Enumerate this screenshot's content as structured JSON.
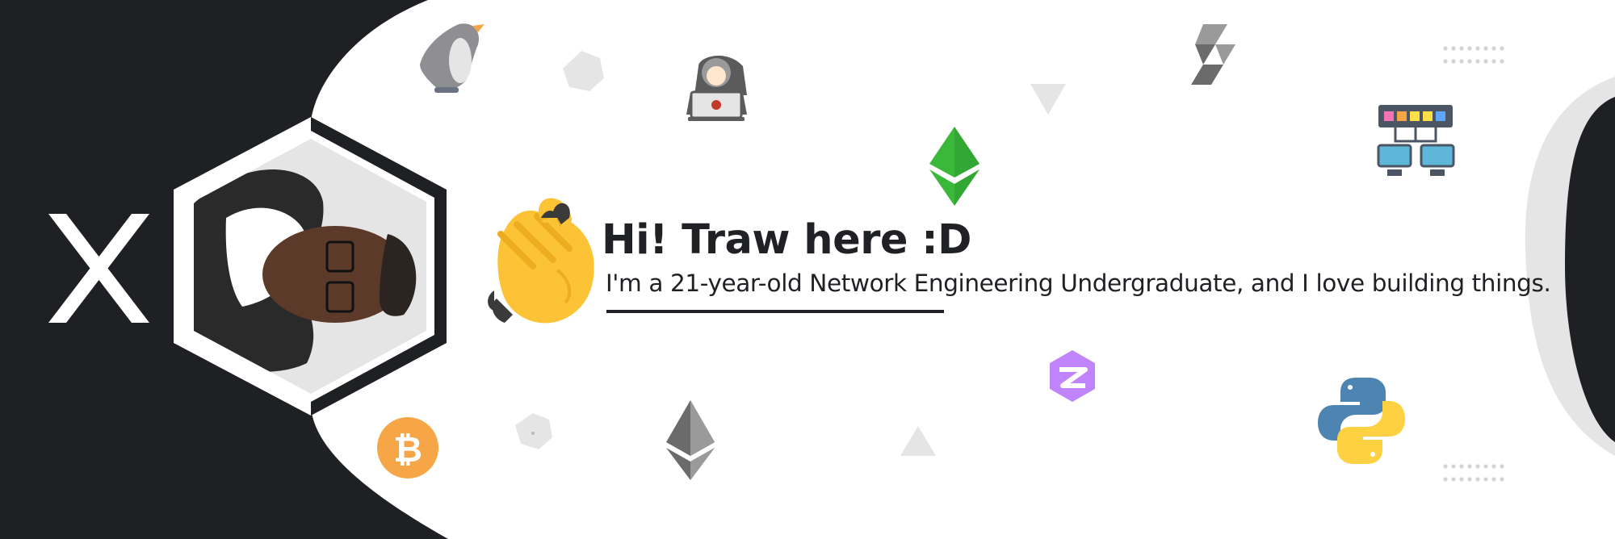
{
  "banner": {
    "headline": "Hi! Traw here :D",
    "tagline": "I'm a 21-year-old Network Engineering Undergraduate, and I love building things."
  },
  "logo": {
    "name": "x-logo-icon",
    "color": "#ffffff"
  },
  "avatar": {
    "name": "avatar"
  },
  "decor_icons": [
    "penguin-icon",
    "hacker-icon",
    "ethereum-classic-icon",
    "solidity-icon",
    "network-icon",
    "bitcoin-icon",
    "ethereum-icon",
    "zksync-icon",
    "python-icon",
    "wave-hand-icon"
  ],
  "colors": {
    "dark": "#1f2024",
    "light_grey": "#e5e5e5",
    "bitcoin": "#f7a647",
    "ethereum_classic": "#3ab83a",
    "python_blue": "#3b77a8",
    "python_yellow": "#fed142",
    "zksync": "#c084fc"
  }
}
